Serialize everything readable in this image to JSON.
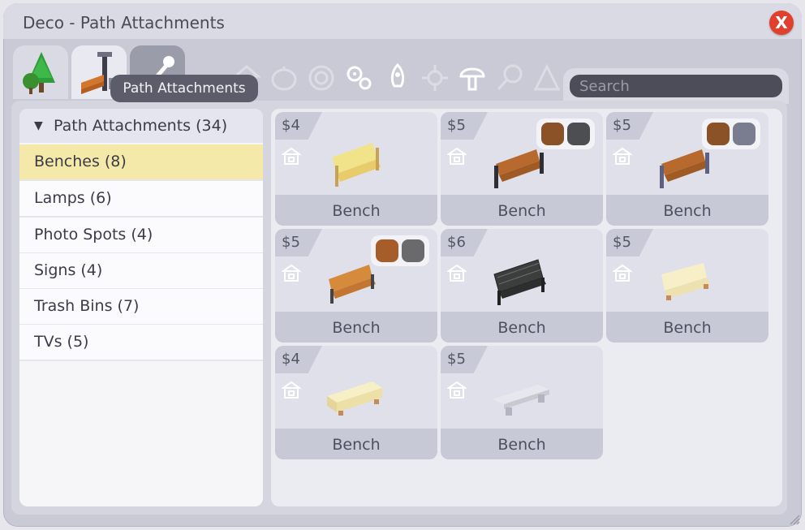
{
  "window": {
    "title": "Deco - Path Attachments",
    "close_label": "X"
  },
  "tooltip": "Path Attachments",
  "search": {
    "placeholder": "Search",
    "value": ""
  },
  "tabs": [
    {
      "name": "trees-tab",
      "icon": "tree-icon"
    },
    {
      "name": "path-attachments-tab",
      "icon": "bench-lamp-icon"
    },
    {
      "name": "eyedropper-tab",
      "icon": "eyedropper-icon"
    }
  ],
  "category_icons": [
    "house-icon",
    "pumpkin-icon",
    "target-icon",
    "gears-icon",
    "rocket-icon",
    "virus-icon",
    "mushroom-icon",
    "lollipop-icon",
    "pyramid-icon"
  ],
  "sidebar": {
    "header": "Path Attachments (34)",
    "items": [
      {
        "label": "Benches (8)",
        "selected": true
      },
      {
        "label": "Lamps (6)"
      },
      {
        "label": "Photo Spots (4)"
      },
      {
        "label": "Signs (4)"
      },
      {
        "label": "Trash Bins (7)"
      },
      {
        "label": "TVs (5)"
      }
    ]
  },
  "items": [
    {
      "price": "$4",
      "label": "Bench",
      "swatches": []
    },
    {
      "price": "$5",
      "label": "Bench",
      "swatches": [
        "#8a5226",
        "#4d4e52"
      ]
    },
    {
      "price": "$5",
      "label": "Bench",
      "swatches": [
        "#8a5226",
        "#7a7c90"
      ]
    },
    {
      "price": "$5",
      "label": "Bench",
      "swatches": [
        "#a65d2a",
        "#6a6a6c"
      ]
    },
    {
      "price": "$6",
      "label": "Bench",
      "swatches": []
    },
    {
      "price": "$5",
      "label": "Bench",
      "swatches": []
    },
    {
      "price": "$4",
      "label": "Bench",
      "swatches": []
    },
    {
      "price": "$5",
      "label": "Bench",
      "swatches": []
    }
  ]
}
